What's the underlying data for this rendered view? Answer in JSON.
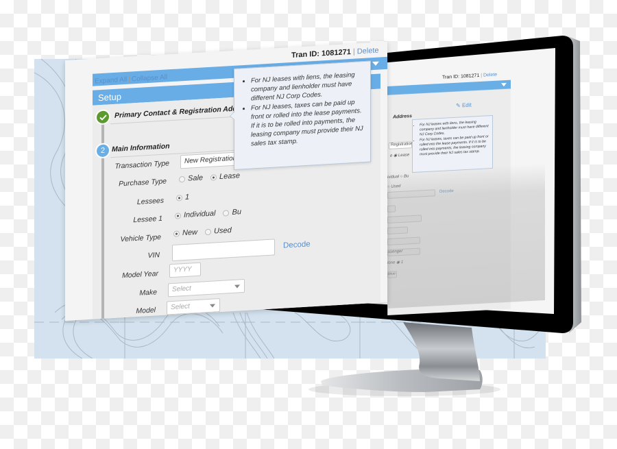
{
  "header": {
    "tran_id_label": "Tran ID: 1081271",
    "delete_label": "Delete",
    "separator": "|"
  },
  "toolbar": {
    "expand_all": "Expand All",
    "collapse_all": "Collapse All",
    "separator": "|"
  },
  "setup": {
    "title": "Setup",
    "edit_label": "Edit",
    "steps": [
      {
        "number": "1",
        "label": "Primary Contact & Registration Address",
        "status": "complete"
      },
      {
        "number": "2",
        "label": "Main Information",
        "status": "current"
      }
    ]
  },
  "form": {
    "transaction_type": {
      "label": "Transaction Type",
      "value": "New Registration"
    },
    "purchase_type": {
      "label": "Purchase Type",
      "options": [
        "Sale",
        "Lease"
      ],
      "selected": "Lease"
    },
    "lessees": {
      "label": "Lessees",
      "options": [
        "1"
      ],
      "selected": "1"
    },
    "lessee_1": {
      "label": "Lessee 1",
      "options": [
        "Individual",
        "Bu"
      ],
      "selected": "Individual"
    },
    "vehicle_type": {
      "label": "Vehicle Type",
      "options": [
        "New",
        "Used"
      ],
      "selected": "New"
    },
    "vin": {
      "label": "VIN",
      "value": "",
      "decode_label": "Decode"
    },
    "model_year": {
      "label": "Model Year",
      "placeholder": "YYYY"
    },
    "make": {
      "label": "Make",
      "placeholder": "Select"
    },
    "model": {
      "label": "Model",
      "placeholder": "Select"
    }
  },
  "tooltip": {
    "items": [
      "For NJ leases with liens, the leasing company and lienholder must have different NJ Corp Codes.",
      "For NJ leases, taxes can be paid up front or rolled into the lease payments. If it is to be rolled into payments, the leasing company must provide their NJ sales tax stamp."
    ]
  },
  "monitor_screen": {
    "tran_id_label": "Tran ID: 1081271",
    "delete_label": "Delete",
    "edit_label": "Edit",
    "address_fragment": "Address",
    "registration_fragment": "Registration",
    "lease_fragment": "Lease",
    "individual_fragment": "ividual",
    "bu_fragment": "Bu",
    "used_label": "Used",
    "decode_label": "Decode",
    "passenger_fragment": "ssenger",
    "one_fragment": "lone",
    "one_value": "1",
    "continue_fragment": "tinue"
  },
  "colors": {
    "accent_blue": "#68ade6",
    "link_blue": "#5b8fc9",
    "success_green": "#5a9a2e",
    "map_background": "#d3e2ee",
    "tooltip_bg": "#edf1f7"
  }
}
